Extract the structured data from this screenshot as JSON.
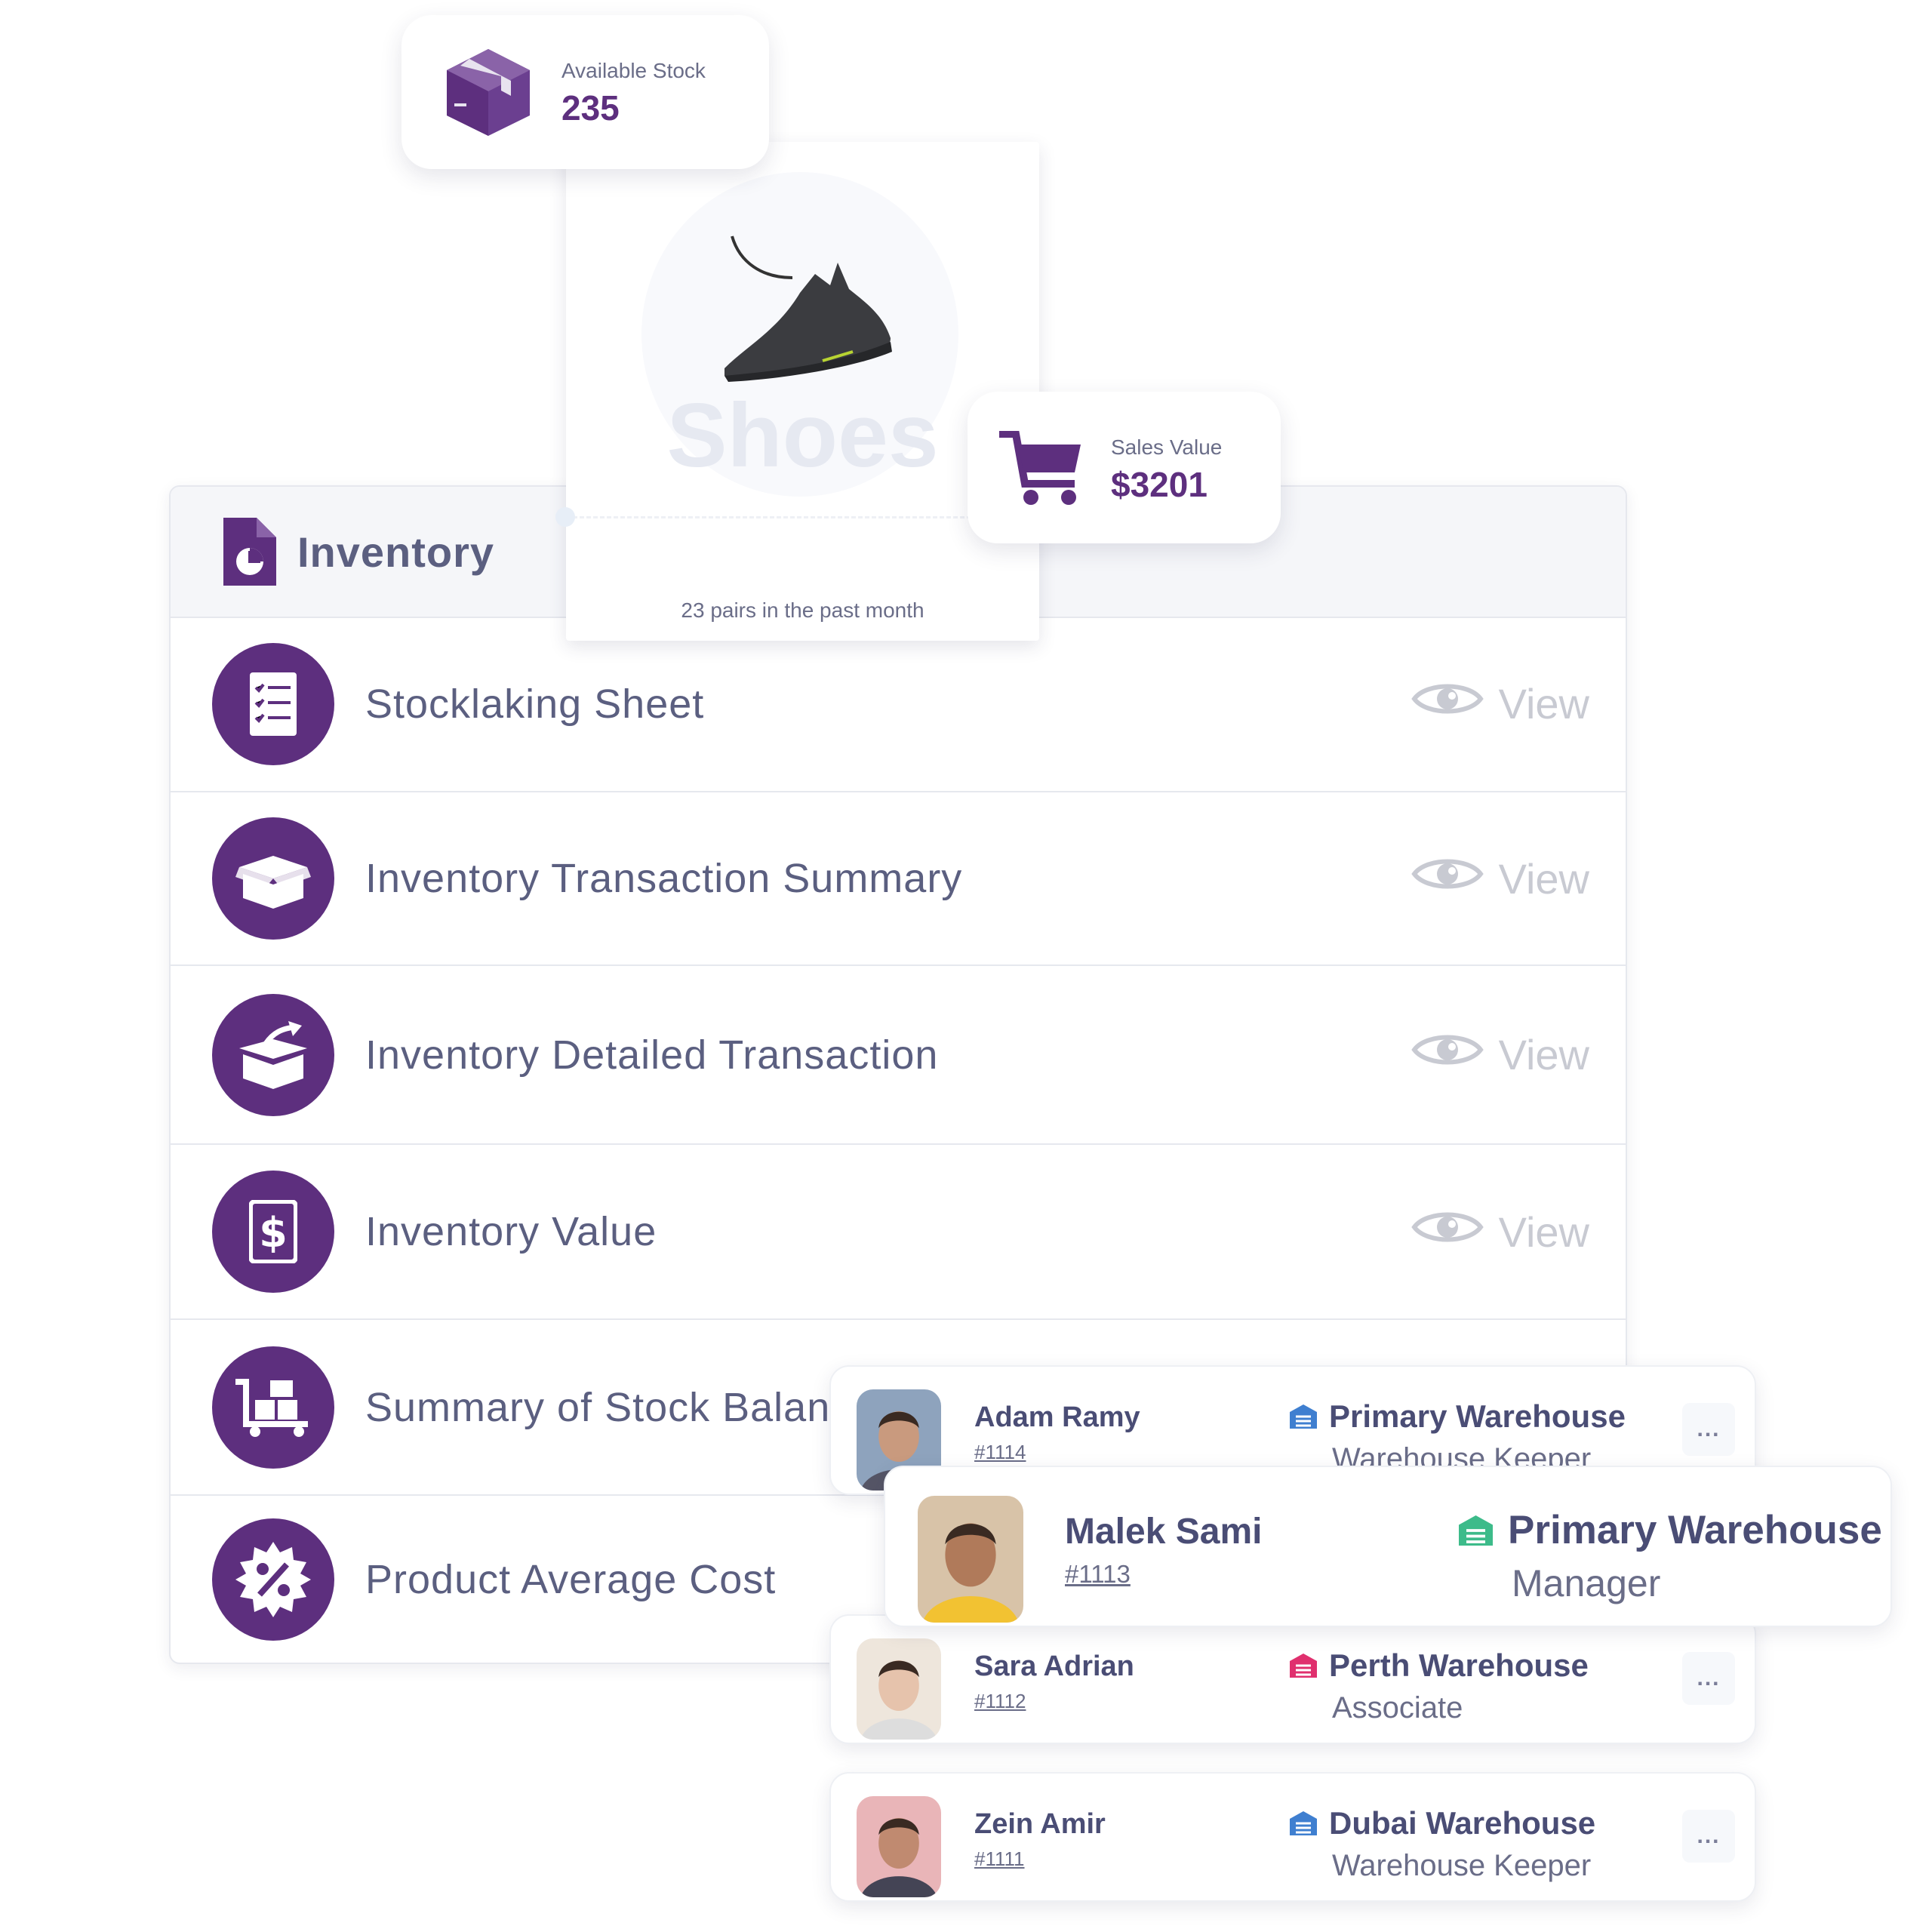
{
  "stock_card": {
    "label": "Available Stock",
    "value": "235",
    "icon": "box-icon"
  },
  "sales_card": {
    "label": "Sales Value",
    "value": "$3201",
    "icon": "cart-icon"
  },
  "product_card": {
    "title": "Shoes",
    "subtitle": "23 pairs in the past month"
  },
  "inventory": {
    "title": "Inventory",
    "view_label": "View",
    "items": [
      {
        "label": "Stocklaking Sheet",
        "icon": "checklist-icon",
        "has_view": true
      },
      {
        "label": "Inventory Transaction Summary",
        "icon": "open-box-icon",
        "has_view": true
      },
      {
        "label": "Inventory Detailed Transaction",
        "icon": "box-arrow-icon",
        "has_view": true
      },
      {
        "label": "Inventory Value",
        "icon": "dollar-doc-icon",
        "has_view": true
      },
      {
        "label": "Summary of Stock Balan",
        "icon": "trolley-icon",
        "has_view": false
      },
      {
        "label": "Product Average Cost",
        "icon": "percent-badge-icon",
        "has_view": false
      }
    ]
  },
  "people": [
    {
      "name": "Adam Ramy",
      "id": "#1114",
      "warehouse": "Primary Warehouse",
      "role": "Warehouse Keeper",
      "wh_color": "#3f7fd0"
    },
    {
      "name": "Malek Sami",
      "id": "#1113",
      "warehouse": "Primary Warehouse",
      "role": "Manager",
      "wh_color": "#3dbb8a"
    },
    {
      "name": "Sara Adrian",
      "id": "#1112",
      "warehouse": "Perth Warehouse",
      "role": "Associate",
      "wh_color": "#e0306e"
    },
    {
      "name": "Zein Amir",
      "id": "#1111",
      "warehouse": "Dubai Warehouse",
      "role": "Warehouse Keeper",
      "wh_color": "#3f7fd0"
    }
  ],
  "more_label": "...",
  "colors": {
    "accent": "#5d2f7e",
    "text": "#4a4d75",
    "muted": "#c8cad2"
  }
}
